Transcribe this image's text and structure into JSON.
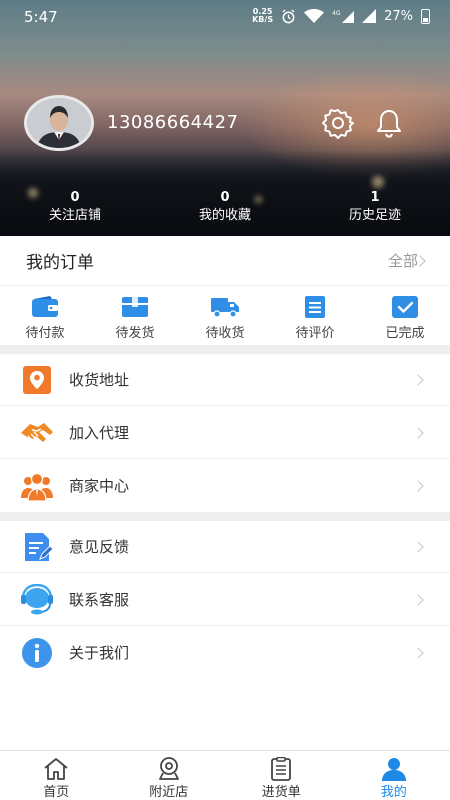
{
  "status_bar": {
    "time": "5:47",
    "net_speed_value": "0.25",
    "net_speed_unit": "KB/S",
    "network_type": "4G",
    "battery": "27%"
  },
  "profile": {
    "phone": "13086664427",
    "avatar_icon": "user-avatar-icon",
    "settings_icon": "gear-icon",
    "notification_icon": "bell-icon"
  },
  "stats": [
    {
      "value": "0",
      "label": "关注店铺"
    },
    {
      "value": "0",
      "label": "我的收藏"
    },
    {
      "value": "1",
      "label": "历史足迹"
    }
  ],
  "orders": {
    "title": "我的订单",
    "all_label": "全部",
    "items": [
      {
        "label": "待付款",
        "icon": "wallet-icon"
      },
      {
        "label": "待发货",
        "icon": "package-icon"
      },
      {
        "label": "待收货",
        "icon": "truck-icon"
      },
      {
        "label": "待评价",
        "icon": "clipboard-icon"
      },
      {
        "label": "已完成",
        "icon": "checkbox-icon"
      }
    ]
  },
  "menu_group_1": [
    {
      "label": "收货地址",
      "icon": "location-pin-icon"
    },
    {
      "label": "加入代理",
      "icon": "handshake-icon"
    },
    {
      "label": "商家中心",
      "icon": "merchant-icon"
    }
  ],
  "menu_group_2": [
    {
      "label": "意见反馈",
      "icon": "feedback-icon"
    },
    {
      "label": "联系客服",
      "icon": "headset-icon"
    },
    {
      "label": "关于我们",
      "icon": "info-icon"
    }
  ],
  "bottom_nav": [
    {
      "label": "首页",
      "icon": "home-icon",
      "active": false
    },
    {
      "label": "附近店",
      "icon": "nearby-icon",
      "active": false
    },
    {
      "label": "进货单",
      "icon": "order-list-icon",
      "active": false
    },
    {
      "label": "我的",
      "icon": "profile-icon",
      "active": true
    }
  ],
  "colors": {
    "accent": "#1e88e5",
    "icon_blue": "#2f8fe6",
    "icon_orange": "#f07a2a",
    "divider": "#eeeeee"
  }
}
